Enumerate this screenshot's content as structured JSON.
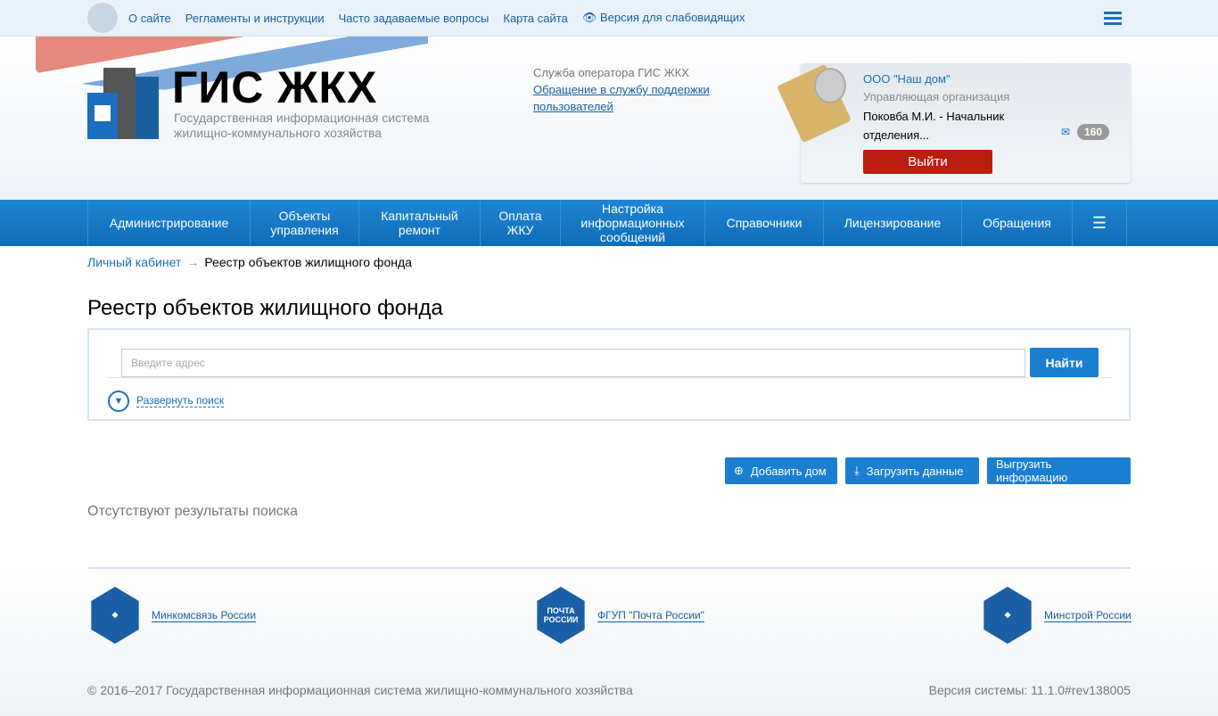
{
  "topbar": {
    "links": [
      "О сайте",
      "Регламенты и инструкции",
      "Часто задаваемые вопросы",
      "Карта сайта",
      "Версия для слабовидящих"
    ]
  },
  "logo": {
    "title": "ГИС ЖКХ",
    "subtitle": "Государственная информационная система жилищно-коммунального хозяйства"
  },
  "support": {
    "label": "Служба оператора ГИС ЖКХ",
    "link": "Обращение в службу поддержки пользователей"
  },
  "user": {
    "org": "ООО \"Наш дом\"",
    "role": "Управляющая организация",
    "name": "Поковба М.И. - Начальник отделения...",
    "messages": "160",
    "logout": "Выйти"
  },
  "nav": [
    "Администрирование",
    "Объекты управления",
    "Капитальный ремонт",
    "Оплата ЖКУ",
    "Настройка информационных сообщений",
    "Справочники",
    "Лицензирование",
    "Обращения"
  ],
  "breadcrumb": {
    "home": "Личный кабинет",
    "current": "Реестр объектов жилищного фонда"
  },
  "page_title": "Реестр объектов жилищного фонда",
  "search": {
    "placeholder": "Введите адрес",
    "find": "Найти",
    "expand": "Развернуть поиск"
  },
  "actions": {
    "add": "Добавить дом",
    "upload": "Загрузить данные",
    "export": "Выгрузить информацию"
  },
  "no_results": "Отсутствуют результаты поиска",
  "footer": {
    "partners": [
      "Минкомсвязь России",
      "ФГУП \"Почта России\"",
      "Минстрой России"
    ],
    "pochta_logo": "ПОЧТА РОССИИ",
    "copyright": "© 2016–2017 Государственная информационная система жилищно-коммунального хозяйства",
    "version": "Версия системы: 11.1.0#rev138005"
  }
}
